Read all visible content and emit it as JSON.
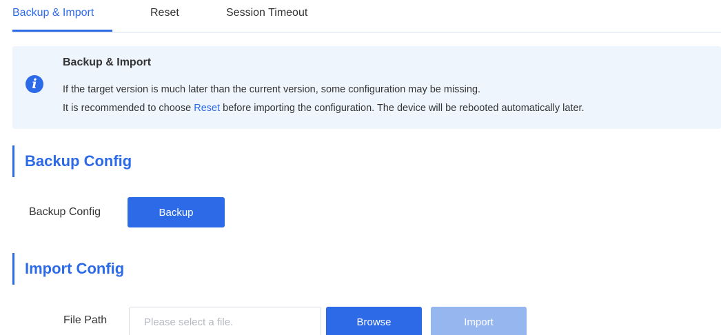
{
  "tabs": [
    {
      "label": "Backup & Import",
      "active": true
    },
    {
      "label": "Reset",
      "active": false
    },
    {
      "label": "Session Timeout",
      "active": false
    }
  ],
  "notice": {
    "icon": "info-icon",
    "title": "Backup & Import",
    "line1": "If the target version is much later than the current version, some configuration may be missing.",
    "line2_prefix": "It is recommended to choose ",
    "line2_link": "Reset",
    "line2_suffix": " before importing the configuration. The device will be rebooted automatically later."
  },
  "backup_section": {
    "title": "Backup Config",
    "label": "Backup Config",
    "button_label": "Backup"
  },
  "import_section": {
    "title": "Import Config",
    "file_label": "File Path",
    "file_value": "",
    "file_placeholder": "Please select a file.",
    "browse_label": "Browse",
    "import_label": "Import",
    "import_disabled": true
  },
  "colors": {
    "accent": "#2d6ae8",
    "notice_bg": "#eff5fd",
    "disabled_button": "#96b6f0"
  }
}
